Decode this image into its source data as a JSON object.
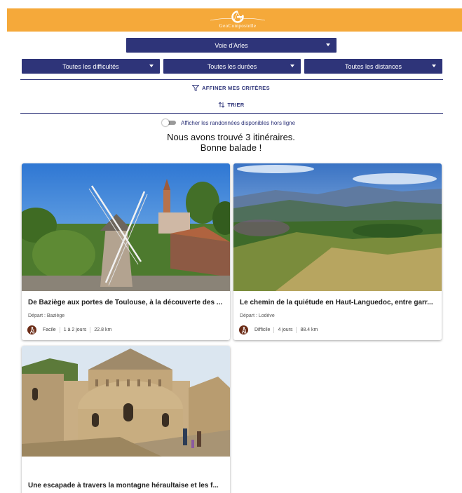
{
  "header": {
    "brand_name": "GeoCompostelle",
    "brand_color": "#f5a93a"
  },
  "filters": {
    "route": "Voie d'Arles",
    "difficulty": "Toutes les difficultés",
    "duration": "Toutes les durées",
    "distance": "Toutes les distances",
    "accent_color": "#2e3479"
  },
  "actions": {
    "refine_label": "AFFINER MES CRITÈRES",
    "sort_label": "TRIER"
  },
  "offline": {
    "label": "Afficher les randonnées disponibles hors ligne",
    "enabled": false
  },
  "results": {
    "line1": "Nous avons trouvé 3 itinéraires.",
    "line2": "Bonne balade !"
  },
  "cards": [
    {
      "title": "De Baziège aux portes de Toulouse, à la découverte des ...",
      "start": "Départ : Baziège",
      "difficulty": "Facile",
      "duration": "1 à 2 jours",
      "distance": "22.8 km",
      "icon": "hiker-icon"
    },
    {
      "title": "Le chemin de la quiétude en Haut-Languedoc, entre garr...",
      "start": "Départ : Lodève",
      "difficulty": "Difficile",
      "duration": "4 jours",
      "distance": "88.4 km",
      "icon": "hiker-icon"
    },
    {
      "title": "Une escapade à travers la montagne héraultaise et les f..."
    }
  ]
}
